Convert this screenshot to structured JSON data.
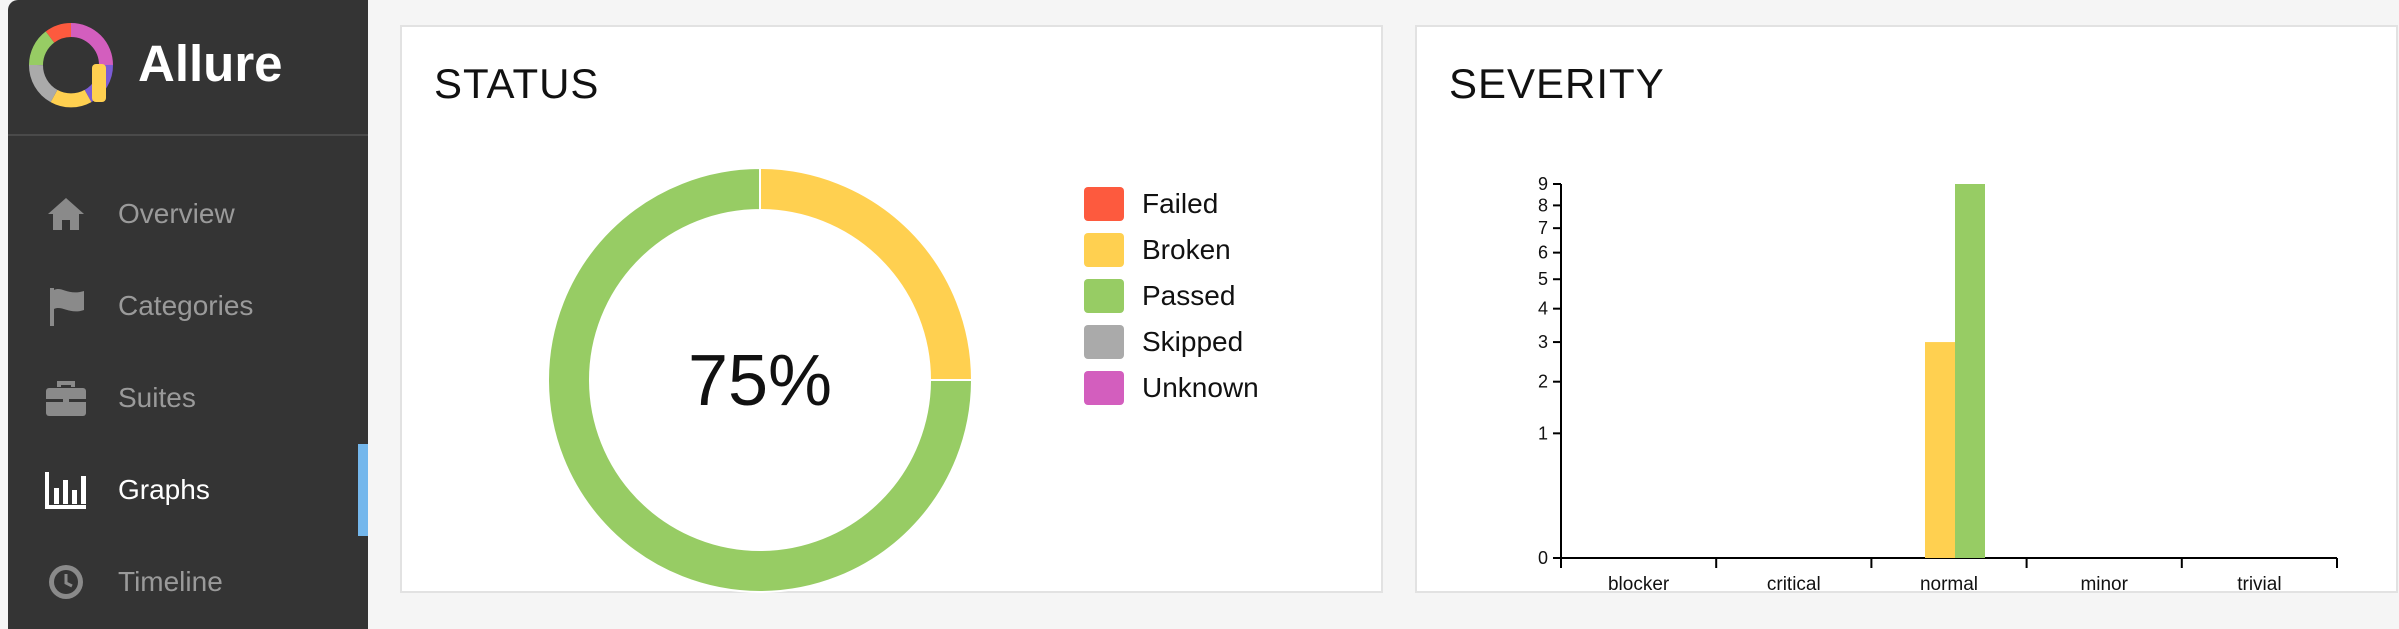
{
  "brand": {
    "name": "Allure"
  },
  "sidebar": {
    "items": [
      {
        "label": "Overview",
        "icon": "home-icon",
        "active": false
      },
      {
        "label": "Categories",
        "icon": "flag-icon",
        "active": false
      },
      {
        "label": "Suites",
        "icon": "briefcase-icon",
        "active": false
      },
      {
        "label": "Graphs",
        "icon": "bar-chart-icon",
        "active": true
      },
      {
        "label": "Timeline",
        "icon": "clock-icon",
        "active": false
      }
    ]
  },
  "colors": {
    "failed": "#fd5a3e",
    "broken": "#ffd050",
    "passed": "#97cc64",
    "skipped": "#aaaaaa",
    "unknown": "#d35ebe",
    "sidebar_bg": "#343434",
    "active_accent": "#74b7ec"
  },
  "status": {
    "title": "STATUS",
    "center_text": "75%",
    "legend": [
      {
        "label": "Failed",
        "color": "#fd5a3e"
      },
      {
        "label": "Broken",
        "color": "#ffd050"
      },
      {
        "label": "Passed",
        "color": "#97cc64"
      },
      {
        "label": "Skipped",
        "color": "#aaaaaa"
      },
      {
        "label": "Unknown",
        "color": "#d35ebe"
      }
    ]
  },
  "severity": {
    "title": "SEVERITY"
  },
  "chart_data": [
    {
      "type": "pie",
      "title": "STATUS",
      "center_label": "75%",
      "slices": [
        {
          "label": "Broken",
          "value": 3,
          "color": "#ffd050"
        },
        {
          "label": "Passed",
          "value": 9,
          "color": "#97cc64"
        }
      ]
    },
    {
      "type": "bar",
      "title": "SEVERITY",
      "categories": [
        "blocker",
        "critical",
        "normal",
        "minor",
        "trivial"
      ],
      "series": [
        {
          "name": "Broken",
          "color": "#ffd050",
          "values": [
            0,
            0,
            3,
            0,
            0
          ]
        },
        {
          "name": "Passed",
          "color": "#97cc64",
          "values": [
            0,
            0,
            9,
            0,
            0
          ]
        }
      ],
      "yticks": [
        "0",
        "1",
        "2",
        "3",
        "4",
        "5",
        "6",
        "7",
        "8",
        "9"
      ],
      "ylim": [
        0,
        9
      ],
      "yscale": "sqrt"
    }
  ]
}
